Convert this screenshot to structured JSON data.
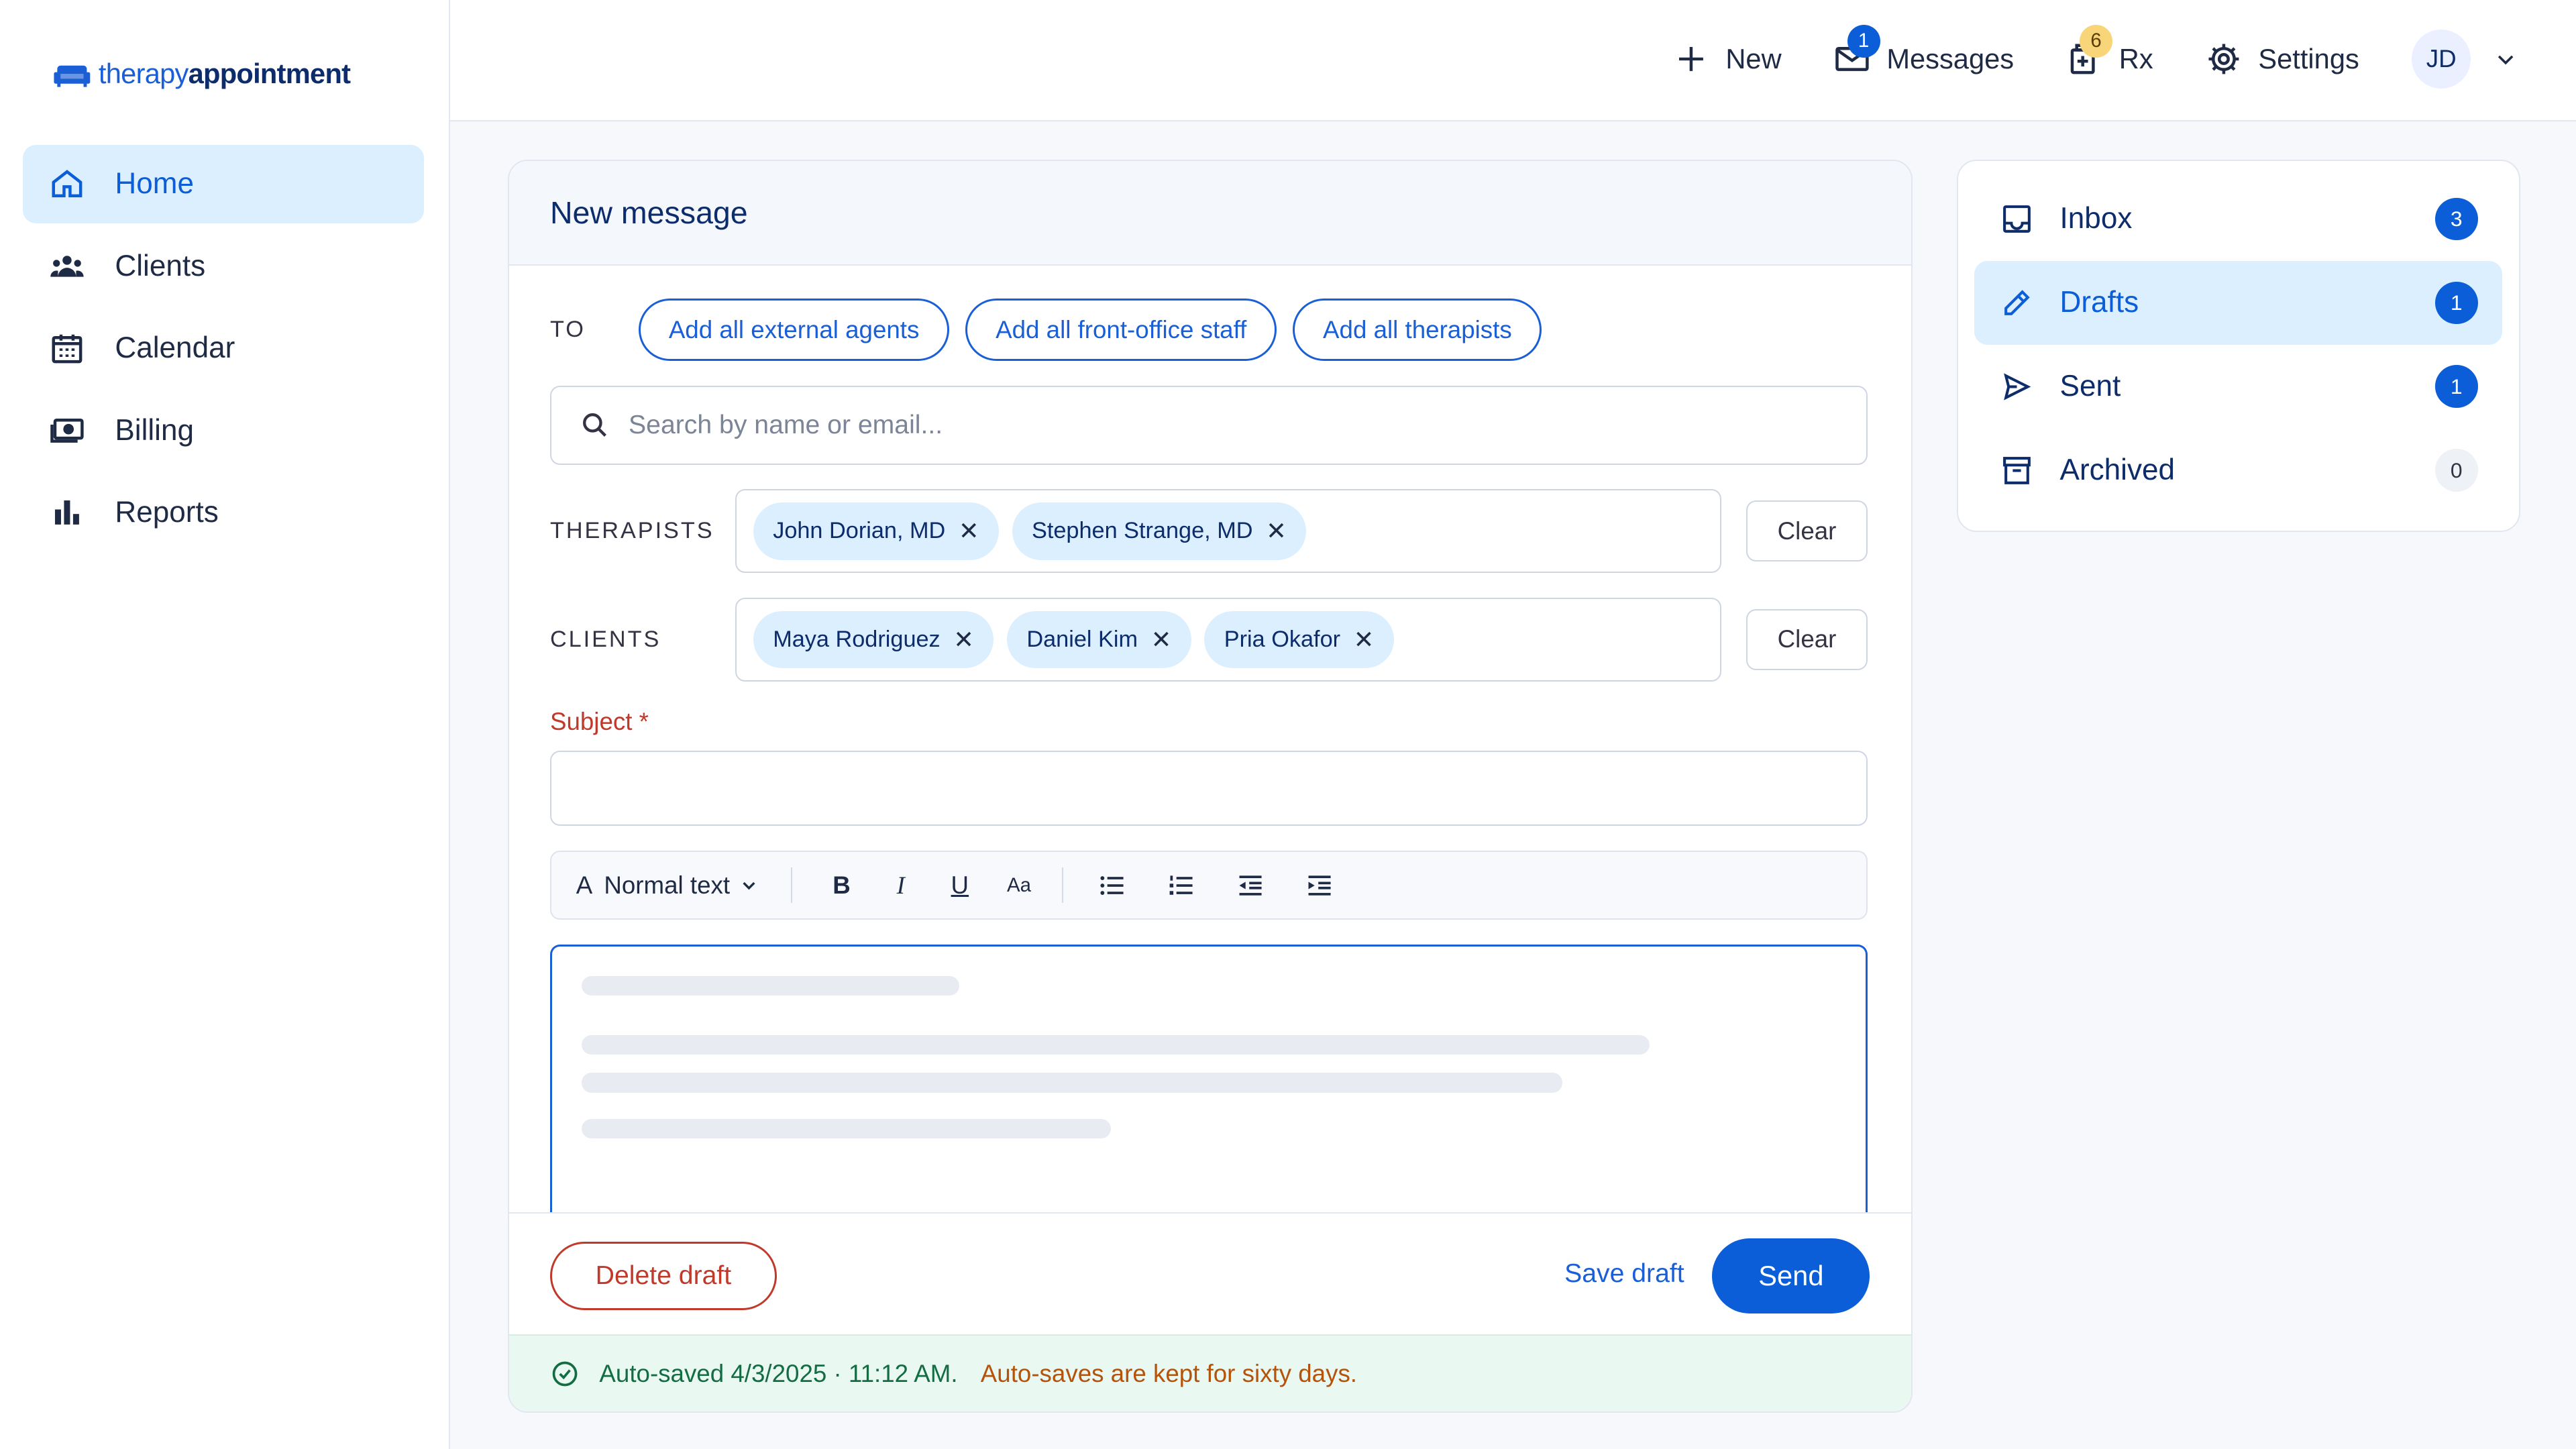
{
  "brand": {
    "thin": "therapy",
    "bold": "appointment"
  },
  "colors": {
    "primary": "#0b5ed7",
    "danger": "#c0392b",
    "success": "#146c43",
    "warning": "#b45309",
    "active_bg": "#dcefff"
  },
  "sidebar": {
    "items": [
      {
        "label": "Home",
        "icon": "home-icon",
        "active": true
      },
      {
        "label": "Clients",
        "icon": "users-icon"
      },
      {
        "label": "Calendar",
        "icon": "calendar-icon"
      },
      {
        "label": "Billing",
        "icon": "money-icon"
      },
      {
        "label": "Reports",
        "icon": "bar-chart-icon"
      }
    ]
  },
  "topbar": {
    "new_label": "New",
    "messages_label": "Messages",
    "messages_badge": "1",
    "rx_label": "Rx",
    "rx_badge": "6",
    "settings_label": "Settings",
    "avatar_initials": "JD"
  },
  "composer": {
    "title": "New message",
    "to_label": "TO",
    "quick_add": [
      "Add all external agents",
      "Add all front-office staff",
      "Add all therapists"
    ],
    "search_placeholder": "Search by name or email...",
    "therapists_label": "THERAPISTS",
    "therapists": [
      "John Dorian, MD",
      "Stephen Strange, MD"
    ],
    "clients_label": "CLIENTS",
    "clients": [
      "Maya Rodriguez",
      "Daniel Kim",
      "Pria Okafor"
    ],
    "clear_label": "Clear",
    "subject_label": "Subject *",
    "subject_value": "",
    "toolbar": {
      "text_style": "Normal text",
      "text_style_icon": "A",
      "bold": "B",
      "italic": "I",
      "underline": "U",
      "font_size": "Aa"
    },
    "delete_label": "Delete draft",
    "save_label": "Save draft",
    "send_label": "Send",
    "autosave_text": "Auto-saved 4/3/2025 · 11:12 AM.",
    "autosave_note": "Auto-saves are kept for sixty days."
  },
  "folders": [
    {
      "label": "Inbox",
      "count": "3",
      "icon": "inbox-icon"
    },
    {
      "label": "Drafts",
      "count": "1",
      "icon": "pencil-icon",
      "active": true
    },
    {
      "label": "Sent",
      "count": "1",
      "icon": "send-icon"
    },
    {
      "label": "Archived",
      "count": "0",
      "icon": "archive-icon"
    }
  ]
}
